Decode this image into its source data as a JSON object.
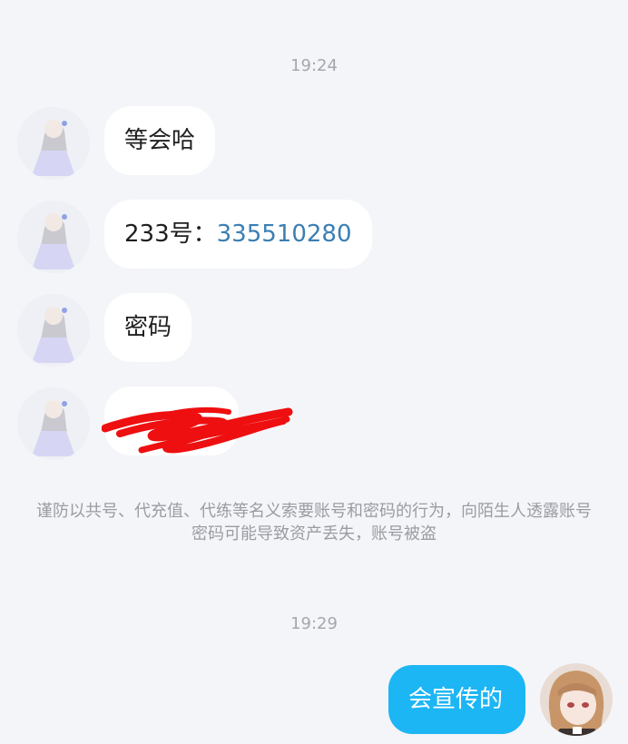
{
  "time_1": "19:24",
  "time_2": "19:29",
  "messages": [
    {
      "text": "等会哈"
    },
    {
      "prefix": "233号：",
      "link": "335510280"
    },
    {
      "text": "密码"
    }
  ],
  "notice": "谨防以共号、代充值、代练等名义索要账号和密码的行为，向陌生人透露账号密码可能导致资产丢失，账号被盗",
  "my_message": "会宣传的",
  "colors": {
    "background": "#f4f5f8",
    "incoming_bubble": "#ffffff",
    "outgoing_bubble": "#1db6f5",
    "link": "#3b7fb2",
    "redaction": "#ee0f10"
  },
  "icons": {
    "contact_avatar": "anime-girl-avatar",
    "my_avatar": "anime-character-avatar"
  }
}
